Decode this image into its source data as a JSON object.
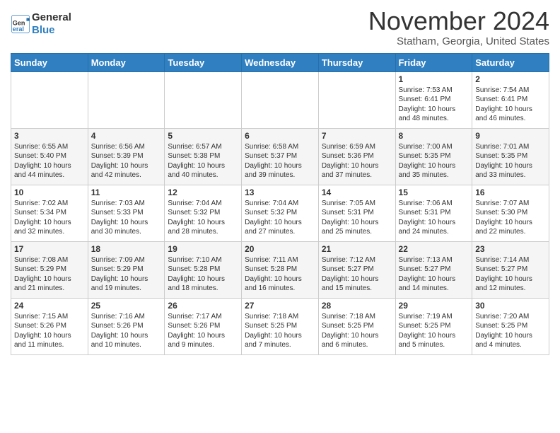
{
  "header": {
    "logo_line1": "General",
    "logo_line2": "Blue",
    "month": "November 2024",
    "location": "Statham, Georgia, United States"
  },
  "days_of_week": [
    "Sunday",
    "Monday",
    "Tuesday",
    "Wednesday",
    "Thursday",
    "Friday",
    "Saturday"
  ],
  "weeks": [
    [
      {
        "day": "",
        "content": ""
      },
      {
        "day": "",
        "content": ""
      },
      {
        "day": "",
        "content": ""
      },
      {
        "day": "",
        "content": ""
      },
      {
        "day": "",
        "content": ""
      },
      {
        "day": "1",
        "content": "Sunrise: 7:53 AM\nSunset: 6:41 PM\nDaylight: 10 hours and 48 minutes."
      },
      {
        "day": "2",
        "content": "Sunrise: 7:54 AM\nSunset: 6:41 PM\nDaylight: 10 hours and 46 minutes."
      }
    ],
    [
      {
        "day": "3",
        "content": "Sunrise: 6:55 AM\nSunset: 5:40 PM\nDaylight: 10 hours and 44 minutes."
      },
      {
        "day": "4",
        "content": "Sunrise: 6:56 AM\nSunset: 5:39 PM\nDaylight: 10 hours and 42 minutes."
      },
      {
        "day": "5",
        "content": "Sunrise: 6:57 AM\nSunset: 5:38 PM\nDaylight: 10 hours and 40 minutes."
      },
      {
        "day": "6",
        "content": "Sunrise: 6:58 AM\nSunset: 5:37 PM\nDaylight: 10 hours and 39 minutes."
      },
      {
        "day": "7",
        "content": "Sunrise: 6:59 AM\nSunset: 5:36 PM\nDaylight: 10 hours and 37 minutes."
      },
      {
        "day": "8",
        "content": "Sunrise: 7:00 AM\nSunset: 5:35 PM\nDaylight: 10 hours and 35 minutes."
      },
      {
        "day": "9",
        "content": "Sunrise: 7:01 AM\nSunset: 5:35 PM\nDaylight: 10 hours and 33 minutes."
      }
    ],
    [
      {
        "day": "10",
        "content": "Sunrise: 7:02 AM\nSunset: 5:34 PM\nDaylight: 10 hours and 32 minutes."
      },
      {
        "day": "11",
        "content": "Sunrise: 7:03 AM\nSunset: 5:33 PM\nDaylight: 10 hours and 30 minutes."
      },
      {
        "day": "12",
        "content": "Sunrise: 7:04 AM\nSunset: 5:32 PM\nDaylight: 10 hours and 28 minutes."
      },
      {
        "day": "13",
        "content": "Sunrise: 7:04 AM\nSunset: 5:32 PM\nDaylight: 10 hours and 27 minutes."
      },
      {
        "day": "14",
        "content": "Sunrise: 7:05 AM\nSunset: 5:31 PM\nDaylight: 10 hours and 25 minutes."
      },
      {
        "day": "15",
        "content": "Sunrise: 7:06 AM\nSunset: 5:31 PM\nDaylight: 10 hours and 24 minutes."
      },
      {
        "day": "16",
        "content": "Sunrise: 7:07 AM\nSunset: 5:30 PM\nDaylight: 10 hours and 22 minutes."
      }
    ],
    [
      {
        "day": "17",
        "content": "Sunrise: 7:08 AM\nSunset: 5:29 PM\nDaylight: 10 hours and 21 minutes."
      },
      {
        "day": "18",
        "content": "Sunrise: 7:09 AM\nSunset: 5:29 PM\nDaylight: 10 hours and 19 minutes."
      },
      {
        "day": "19",
        "content": "Sunrise: 7:10 AM\nSunset: 5:28 PM\nDaylight: 10 hours and 18 minutes."
      },
      {
        "day": "20",
        "content": "Sunrise: 7:11 AM\nSunset: 5:28 PM\nDaylight: 10 hours and 16 minutes."
      },
      {
        "day": "21",
        "content": "Sunrise: 7:12 AM\nSunset: 5:27 PM\nDaylight: 10 hours and 15 minutes."
      },
      {
        "day": "22",
        "content": "Sunrise: 7:13 AM\nSunset: 5:27 PM\nDaylight: 10 hours and 14 minutes."
      },
      {
        "day": "23",
        "content": "Sunrise: 7:14 AM\nSunset: 5:27 PM\nDaylight: 10 hours and 12 minutes."
      }
    ],
    [
      {
        "day": "24",
        "content": "Sunrise: 7:15 AM\nSunset: 5:26 PM\nDaylight: 10 hours and 11 minutes."
      },
      {
        "day": "25",
        "content": "Sunrise: 7:16 AM\nSunset: 5:26 PM\nDaylight: 10 hours and 10 minutes."
      },
      {
        "day": "26",
        "content": "Sunrise: 7:17 AM\nSunset: 5:26 PM\nDaylight: 10 hours and 9 minutes."
      },
      {
        "day": "27",
        "content": "Sunrise: 7:18 AM\nSunset: 5:25 PM\nDaylight: 10 hours and 7 minutes."
      },
      {
        "day": "28",
        "content": "Sunrise: 7:18 AM\nSunset: 5:25 PM\nDaylight: 10 hours and 6 minutes."
      },
      {
        "day": "29",
        "content": "Sunrise: 7:19 AM\nSunset: 5:25 PM\nDaylight: 10 hours and 5 minutes."
      },
      {
        "day": "30",
        "content": "Sunrise: 7:20 AM\nSunset: 5:25 PM\nDaylight: 10 hours and 4 minutes."
      }
    ]
  ]
}
